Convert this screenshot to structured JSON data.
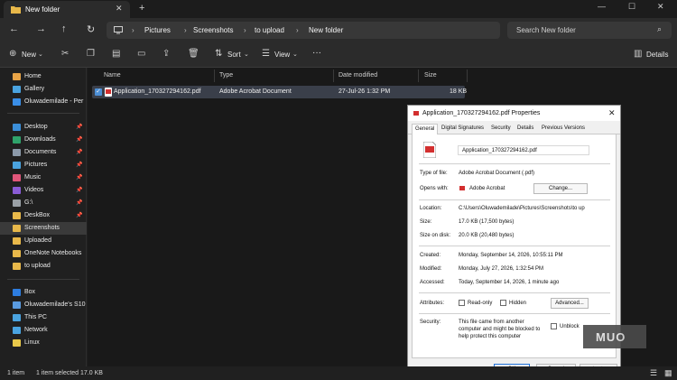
{
  "window": {
    "tab_title": "New folder",
    "new_tab": "+",
    "tab_close": "✕",
    "minimize": "—",
    "maximize": "☐",
    "close": "✕"
  },
  "address_bar": {
    "crumbs": [
      "Pictures",
      "Screenshots",
      "to upload",
      "New folder"
    ],
    "separator": "›"
  },
  "search": {
    "placeholder": "Search New folder"
  },
  "toolbar": {
    "new_label": "New",
    "sort_label": "Sort",
    "view_label": "View",
    "more_label": "···",
    "details_label": "Details"
  },
  "sidebar": {
    "items": [
      {
        "label": "Home",
        "icon": "home-icon",
        "color": "#e8a447",
        "pinned": false
      },
      {
        "label": "Gallery",
        "icon": "gallery-icon",
        "color": "#4aa3df",
        "pinned": false
      },
      {
        "label": "Oluwademilade - Per",
        "icon": "cloud-icon",
        "color": "#3a8ee6",
        "pinned": false
      },
      {
        "label": "Desktop",
        "icon": "desktop-icon",
        "color": "#3b8fd9",
        "pinned": true
      },
      {
        "label": "Downloads",
        "icon": "download-icon",
        "color": "#2fa36b",
        "pinned": true
      },
      {
        "label": "Documents",
        "icon": "document-icon",
        "color": "#8c9aaa",
        "pinned": true
      },
      {
        "label": "Pictures",
        "icon": "pictures-icon",
        "color": "#4aa3df",
        "pinned": true
      },
      {
        "label": "Music",
        "icon": "music-icon",
        "color": "#e0567a",
        "pinned": true
      },
      {
        "label": "Videos",
        "icon": "videos-icon",
        "color": "#8a5cd6",
        "pinned": true
      },
      {
        "label": "G:\\",
        "icon": "drive-icon",
        "color": "#9aa0a6",
        "pinned": true
      },
      {
        "label": "DeskBox",
        "icon": "folder-icon",
        "color": "#e8b84a",
        "pinned": true
      },
      {
        "label": "Screenshots",
        "icon": "folder-icon",
        "color": "#e8b84a",
        "pinned": false
      },
      {
        "label": "Uploaded",
        "icon": "folder-icon",
        "color": "#e8b84a",
        "pinned": false
      },
      {
        "label": "OneNote Notebooks",
        "icon": "folder-icon",
        "color": "#e8b84a",
        "pinned": false
      },
      {
        "label": "to upload",
        "icon": "folder-icon",
        "color": "#e8b84a",
        "pinned": false
      },
      {
        "label": "Box",
        "icon": "box-icon",
        "color": "#2d7de0",
        "pinned": false
      },
      {
        "label": "Oluwademilade's S10",
        "icon": "phone-icon",
        "color": "#5a9be0",
        "pinned": false
      },
      {
        "label": "This PC",
        "icon": "pc-icon",
        "color": "#4aa3df",
        "pinned": false
      },
      {
        "label": "Network",
        "icon": "network-icon",
        "color": "#4aa3df",
        "pinned": false
      },
      {
        "label": "Linux",
        "icon": "linux-icon",
        "color": "#e8c84a",
        "pinned": false
      }
    ]
  },
  "file_list": {
    "columns": [
      "Name",
      "Type",
      "Date modified",
      "Size"
    ],
    "rows": [
      {
        "name": "Application_170327294162.pdf",
        "type": "Adobe Acrobat Document",
        "date": "27-Jul-26 1:32 PM",
        "size": "18 KB",
        "selected": true
      }
    ]
  },
  "status_bar": {
    "item_count": "1 item",
    "selection": "1 item selected  17.0 KB"
  },
  "properties_dialog": {
    "title": "Application_170327294162.pdf Properties",
    "tabs": [
      "General",
      "Digital Signatures",
      "Security",
      "Details",
      "Previous Versions"
    ],
    "active_tab": "General",
    "file_name": "Application_170327294162.pdf",
    "type_label": "Type of file:",
    "type_value": "Adobe Acrobat Document (.pdf)",
    "opens_label": "Opens with:",
    "opens_value": "Adobe Acrobat",
    "change_button": "Change...",
    "location_label": "Location:",
    "location_value": "C:\\Users\\Oluwademilade\\Pictures\\Screenshots\\to up",
    "size_label": "Size:",
    "size_value": "17.0 KB (17,500 bytes)",
    "size_disk_label": "Size on disk:",
    "size_disk_value": "20.0 KB (20,480 bytes)",
    "created_label": "Created:",
    "created_value": "Monday, September 14, 2026, 10:55:11 PM",
    "modified_label": "Modified:",
    "modified_value": "Monday, July 27, 2026, 1:32:54 PM",
    "accessed_label": "Accessed:",
    "accessed_value": "Today, September 14, 2026, 1 minute ago",
    "attributes_label": "Attributes:",
    "readonly_label": "Read-only",
    "hidden_label": "Hidden",
    "advanced_button": "Advanced...",
    "security_label": "Security:",
    "security_text_1": "This file came from another",
    "security_text_2": "computer and might be blocked to",
    "security_text_3": "help protect this computer",
    "unblock_label": "Unblock",
    "ok_button": "OK",
    "cancel_button": "Cancel",
    "apply_button": "Apply"
  },
  "watermark": {
    "text": "MUO"
  }
}
